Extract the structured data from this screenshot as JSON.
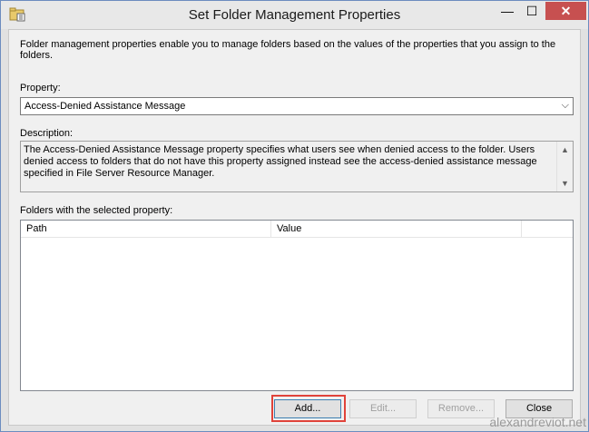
{
  "window": {
    "title": "Set Folder Management Properties",
    "icon": "folder-properties-icon",
    "minimize_glyph": "—",
    "maximize_glyph": "☐",
    "close_glyph": "✕"
  },
  "intro_text": "Folder management properties enable you to manage folders based on the values of the properties that you assign to the folders.",
  "property": {
    "label": "Property:",
    "selected": "Access-Denied Assistance Message",
    "arrow": "⌵"
  },
  "description": {
    "label": "Description:",
    "text": "The Access-Denied Assistance Message property specifies what users see when denied access to the folder. Users denied access to folders that do not have this property assigned instead see the access-denied assistance message specified in File Server Resource Manager.",
    "scroll_up": "▲",
    "scroll_down": "▼"
  },
  "folders": {
    "label": "Folders with the selected property:",
    "columns": [
      "Path",
      "Value",
      ""
    ]
  },
  "buttons": {
    "add": "Add...",
    "edit": "Edit...",
    "remove": "Remove...",
    "close": "Close"
  },
  "watermark": "alexandreviot.net",
  "colors": {
    "close_button": "#c75050",
    "highlight": "#e0433a",
    "frame": "#6c8cbf"
  }
}
